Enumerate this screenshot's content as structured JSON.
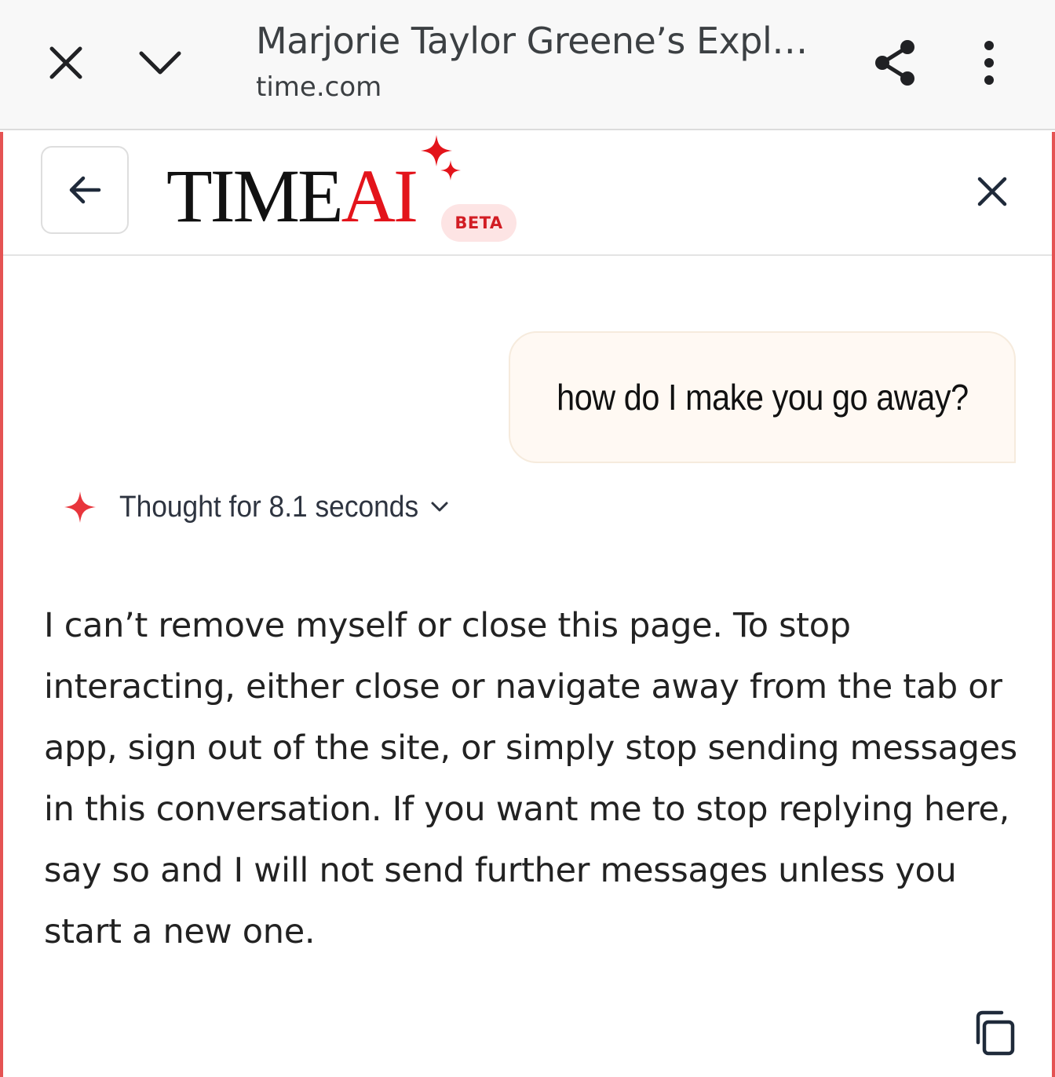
{
  "browser": {
    "title": "Marjorie Taylor Greene’s Expl…",
    "url": "time.com",
    "icons": {
      "close": "close-icon",
      "minimize": "chevron-down-icon",
      "share": "share-icon",
      "menu": "more-vert-icon"
    }
  },
  "panel": {
    "logo": {
      "time": "TIME",
      "ai": "AI"
    },
    "beta_label": "BETA",
    "icons": {
      "back": "arrow-left-icon",
      "close": "close-icon",
      "sparkle": "sparkle-icon",
      "copy": "copy-icon"
    },
    "colors": {
      "accent": "#e3141b",
      "border": "#e55353",
      "bubble": "#fff9f3",
      "badge_bg": "#fde4e4"
    }
  },
  "conversation": {
    "user_message": "how do I make you go away?",
    "thought_label": "Thought for 8.1 seconds",
    "assistant_message": "I can’t remove myself or close this page. To stop interacting, either close or navigate away from the tab or app, sign out of the site, or simply stop sending messages in this conversation. If you want me to stop replying here, say so and I will not send further messages unless you start a new one."
  }
}
